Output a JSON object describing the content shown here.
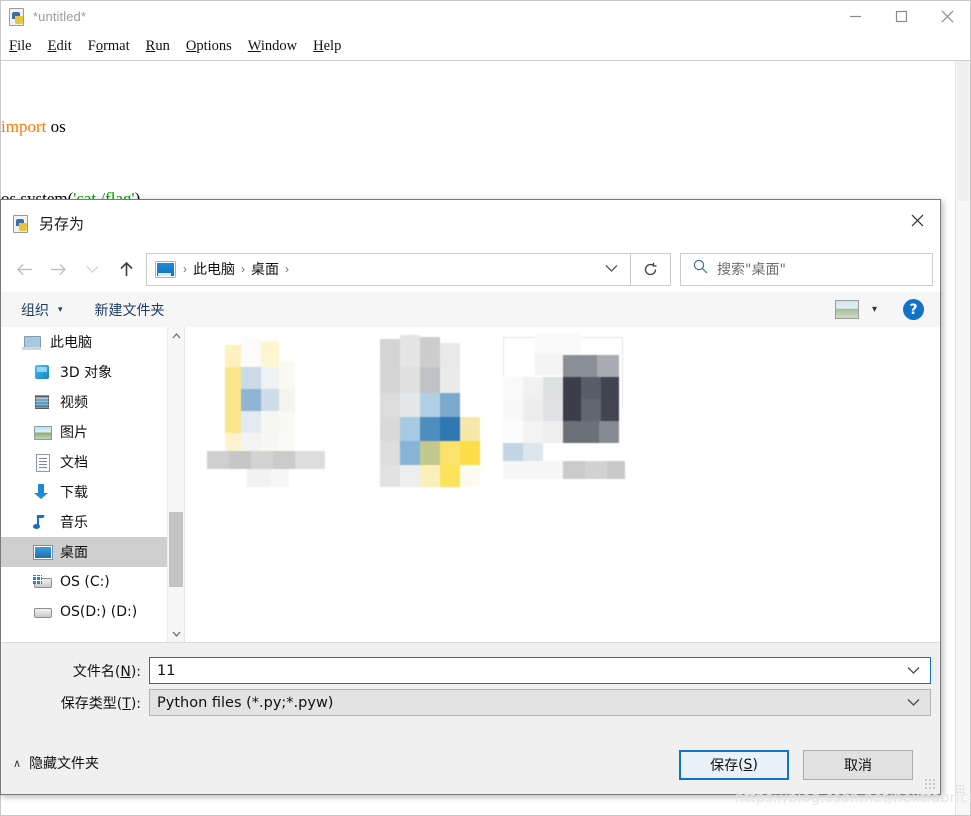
{
  "editor": {
    "title": "*untitled*",
    "app_icon": "python-file-icon",
    "window_controls": {
      "minimize": "minimize-icon",
      "maximize": "maximize-icon",
      "close": "close-icon"
    },
    "menu": [
      {
        "label": "File",
        "accel": "F"
      },
      {
        "label": "Edit",
        "accel": "E"
      },
      {
        "label": "Format",
        "accel": "o"
      },
      {
        "label": "Run",
        "accel": "R"
      },
      {
        "label": "Options",
        "accel": "O"
      },
      {
        "label": "Window",
        "accel": "W"
      },
      {
        "label": "Help",
        "accel": "H"
      }
    ],
    "code": {
      "line1_keyword": "import",
      "line1_rest": " os",
      "line2_pre": "os.system(",
      "line2_string": "'cat /flag'",
      "line2_post": ")"
    },
    "colors": {
      "keyword": "#ff7700",
      "string": "#00a000",
      "plain": "#000000"
    }
  },
  "dialog": {
    "title": "另存为",
    "icon": "python-file-icon",
    "close_label": "close-icon",
    "nav": {
      "back": "back-arrow-icon",
      "forward": "forward-arrow-icon",
      "recent": "recent-locations-icon",
      "up": "up-arrow-icon",
      "refresh": "refresh-icon"
    },
    "breadcrumb": {
      "root_icon": "this-pc-icon",
      "items": [
        "此电脑",
        "桌面"
      ],
      "separator": "›",
      "expand": "chevron-down-icon"
    },
    "search": {
      "icon": "search-icon",
      "placeholder": "搜索\"桌面\""
    },
    "toolbar": {
      "organize_label": "组织",
      "organize_caret": "▾",
      "new_folder_label": "新建文件夹",
      "view_icon": "view-layout-icon",
      "view_caret": "▾",
      "help_label": "?"
    },
    "sidebar": {
      "items": [
        {
          "label": "此电脑",
          "icon": "this-pc-icon",
          "selected": false
        },
        {
          "label": "3D 对象",
          "icon": "3d-objects-icon",
          "selected": false
        },
        {
          "label": "视频",
          "icon": "videos-icon",
          "selected": false
        },
        {
          "label": "图片",
          "icon": "pictures-icon",
          "selected": false
        },
        {
          "label": "文档",
          "icon": "documents-icon",
          "selected": false
        },
        {
          "label": "下载",
          "icon": "downloads-icon",
          "selected": false
        },
        {
          "label": "音乐",
          "icon": "music-icon",
          "selected": false
        },
        {
          "label": "桌面",
          "icon": "desktop-icon",
          "selected": true
        },
        {
          "label": "OS (C:)",
          "icon": "system-drive-icon",
          "selected": false
        },
        {
          "label": "OS(D:) (D:)",
          "icon": "drive-icon",
          "selected": false
        }
      ],
      "scroll_up": "scroll-up-arrow",
      "scroll_down": "scroll-down-arrow"
    },
    "file_list": {
      "note": "three pixelated/censored file thumbnails",
      "items": [
        {
          "name": "censored-thumbnail-1"
        },
        {
          "name": "censored-thumbnail-2"
        },
        {
          "name": "censored-thumbnail-3"
        }
      ]
    },
    "fields": {
      "filename_label": "文件名",
      "filename_accel": "N",
      "filename_value": "11",
      "filetype_label": "保存类型",
      "filetype_accel": "T",
      "filetype_value": "Python files (*.py;*.pyw)",
      "chevron": "chevron-down-icon"
    },
    "footer": {
      "hide_folders_caret": "∧",
      "hide_folders_label": "隐藏文件夹",
      "save_label": "保存",
      "save_accel": "S",
      "cancel_label": "取消"
    },
    "accent_color": "#1272c8"
  },
  "watermark": "https://blog.csdn.net/nextfabricate"
}
